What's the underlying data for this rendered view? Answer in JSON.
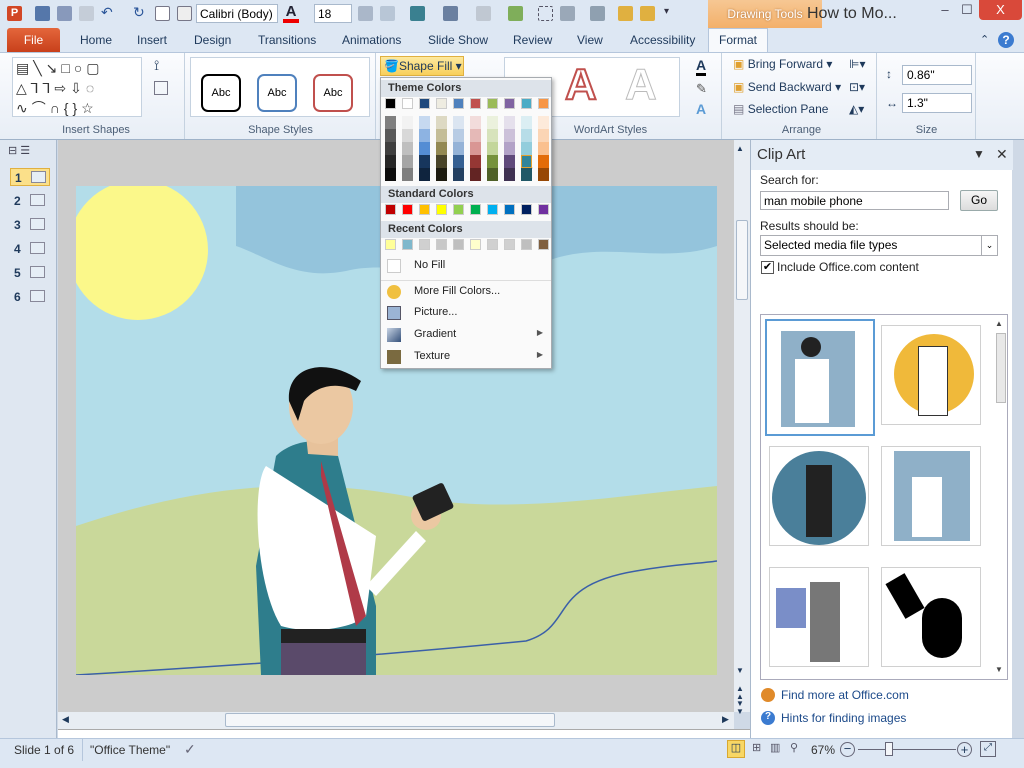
{
  "app": {
    "icon_letter": "P",
    "contextual_tab": "Drawing Tools",
    "doc_title": "How to Mo...",
    "font_name": "Calibri (Body)",
    "font_size": "18"
  },
  "window_controls": {
    "minimize": "–",
    "maximize": "☐",
    "close": "X"
  },
  "tabs": [
    "File",
    "Home",
    "Insert",
    "Design",
    "Transitions",
    "Animations",
    "Slide Show",
    "Review",
    "View",
    "Accessibility",
    "Format"
  ],
  "active_tab": "Format",
  "ribbon": {
    "groups": {
      "insert_shapes": "Insert Shapes",
      "shape_styles": "Shape Styles",
      "wordart_styles": "WordArt Styles",
      "arrange": "Arrange",
      "size": "Size"
    },
    "style_samples": [
      "Abc",
      "Abc",
      "Abc"
    ],
    "style_colors": [
      "#000000",
      "#4f81bd",
      "#c0504d"
    ],
    "shape_fill": "Shape Fill",
    "bring_forward": "Bring Forward",
    "send_backward": "Send Backward",
    "selection_pane": "Selection Pane",
    "height": "0.86\"",
    "width": "1.3\""
  },
  "fill_menu": {
    "theme_header": "Theme Colors",
    "theme_base": [
      "#000000",
      "#ffffff",
      "#1f497d",
      "#eeece1",
      "#4f81bd",
      "#c0504d",
      "#9bbb59",
      "#8064a2",
      "#4bacc6",
      "#f79646"
    ],
    "theme_shades": [
      [
        "#7f7f7f",
        "#595959",
        "#3f3f3f",
        "#262626",
        "#0c0c0c"
      ],
      [
        "#f2f2f2",
        "#d8d8d8",
        "#bfbfbf",
        "#a5a5a5",
        "#7f7f7f"
      ],
      [
        "#c6d9f0",
        "#8db3e2",
        "#548dd4",
        "#17365d",
        "#0f243e"
      ],
      [
        "#ddd9c3",
        "#c4bd97",
        "#938953",
        "#494429",
        "#1d1b10"
      ],
      [
        "#dbe5f1",
        "#b8cce4",
        "#95b3d7",
        "#366092",
        "#244061"
      ],
      [
        "#f2dcdb",
        "#e5b9b7",
        "#d99694",
        "#953734",
        "#632423"
      ],
      [
        "#ebf1dd",
        "#d7e3bc",
        "#c3d69b",
        "#76923c",
        "#4f6128"
      ],
      [
        "#e5e0ec",
        "#ccc1d9",
        "#b2a2c7",
        "#5f497a",
        "#3f3151"
      ],
      [
        "#dbeef3",
        "#b7dde8",
        "#92cddc",
        "#31859b",
        "#205867"
      ],
      [
        "#fdeada",
        "#fbd5b5",
        "#fac08f",
        "#e36c09",
        "#974806"
      ]
    ],
    "hovered_swatch": "#31859b",
    "standard_header": "Standard Colors",
    "standard": [
      "#c00000",
      "#ff0000",
      "#ffc000",
      "#ffff00",
      "#92d050",
      "#00b050",
      "#00b0f0",
      "#0070c0",
      "#002060",
      "#7030a0"
    ],
    "recent_header": "Recent Colors",
    "recent": [
      "#ffff99",
      "#7fb8cc",
      "#d0d0d0",
      "#c8c8c8",
      "#bfbfbf",
      "#ffffcc",
      "#d0d0d0",
      "#d0d0d0",
      "#bfbfbf",
      "#7f5f3f"
    ],
    "items": [
      {
        "label": "No Fill",
        "icon": "no-fill-icon"
      },
      {
        "label": "More Fill Colors...",
        "icon": "palette-icon"
      },
      {
        "label": "Picture...",
        "icon": "picture-icon"
      },
      {
        "label": "Gradient",
        "icon": "gradient-icon",
        "submenu": true
      },
      {
        "label": "Texture",
        "icon": "texture-icon",
        "submenu": true
      }
    ]
  },
  "slides": [
    "1",
    "2",
    "3",
    "4",
    "5",
    "6"
  ],
  "selected_slide": "1",
  "clip_art": {
    "title": "Clip Art",
    "search_label": "Search for:",
    "search_value": "man mobile phone",
    "go": "Go",
    "results_label": "Results should be:",
    "results_value": "Selected media file types",
    "include_office": "Include Office.com content",
    "include_checked": true,
    "find_more": "Find more at Office.com",
    "hints": "Hints for finding images"
  },
  "status": {
    "slide": "Slide 1 of 6",
    "theme": "\"Office Theme\"",
    "zoom": "67%",
    "zoom_level": 67
  },
  "slide_colors": {
    "sky": "#b3dde9",
    "sun": "#fbf88a",
    "cloud": "#94c4dc",
    "hill": "#c9d89a",
    "line": "#3a5fa8"
  }
}
